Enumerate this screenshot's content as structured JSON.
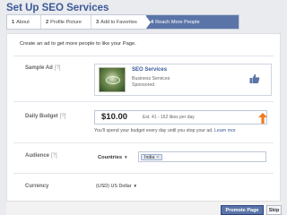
{
  "header": {
    "title": "Set Up SEO Services"
  },
  "steps": [
    {
      "num": "1",
      "label": "About"
    },
    {
      "num": "2",
      "label": "Profile Picture"
    },
    {
      "num": "3",
      "label": "Add to Favorites"
    },
    {
      "num": "4",
      "label": "Reach More People"
    }
  ],
  "intro": "Create an ad to get more people to like your Page.",
  "sample_ad": {
    "label": "Sample Ad",
    "help": "[?]",
    "name": "SEO Services",
    "category": "Business Services",
    "sponsored": "Sponsored"
  },
  "daily_budget": {
    "label": "Daily Budget",
    "help": "[?]",
    "value": "$10.00",
    "estimate": "Est. 41 - 162 likes per day",
    "note": "You'll spend your budget every day until you stop your ad.",
    "learn_more": "Learn mor"
  },
  "audience": {
    "label": "Audience",
    "help": "[?]",
    "type": "Countries",
    "token": "India",
    "token_remove": "×"
  },
  "currency": {
    "label": "Currency",
    "value": "(USD) US Dollar"
  },
  "footer": {
    "promote": "Promote Page",
    "skip": "Skip"
  },
  "icons": {
    "thumb": "thumbs-up-icon",
    "arrow": "arrow-up-icon",
    "caret": "chevron-down-icon"
  },
  "colors": {
    "brand": "#3b5998",
    "active_step": "#5b74a8",
    "arrow": "#f07a1a"
  }
}
